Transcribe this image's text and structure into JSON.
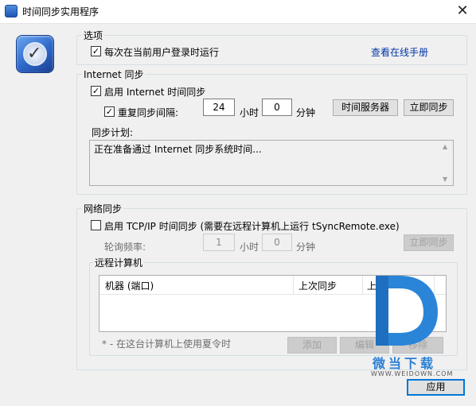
{
  "window": {
    "title": "时间同步实用程序",
    "close_glyph": "✕"
  },
  "options": {
    "legend": "选项",
    "run_at_login_label": "每次在当前用户登录时运行",
    "run_at_login_checked": true,
    "online_manual_link": "查看在线手册"
  },
  "internet_sync": {
    "legend": "Internet 同步",
    "enable_label": "启用 Internet 时间同步",
    "enable_checked": true,
    "repeat_label": "重复同步间隔:",
    "repeat_checked": true,
    "hours_value": "24",
    "hours_unit": "小时",
    "minutes_value": "0",
    "minutes_unit": "分钟",
    "time_server_button": "时间服务器",
    "sync_now_button": "立即同步",
    "schedule_label": "同步计划:",
    "schedule_text": "正在准备通过 Internet 同步系统时间..."
  },
  "network_sync": {
    "legend": "网络同步",
    "enable_label": "启用 TCP/IP 时间同步 (需要在远程计算机上运行 tSyncRemote.exe)",
    "enable_checked": false,
    "poll_label": "轮询频率:",
    "hours_value": "1",
    "hours_unit": "小时",
    "minutes_value": "0",
    "minutes_unit": "分钟",
    "sync_now_button": "立即同步",
    "remote_legend": "远程计算机",
    "columns": [
      "机器 (端口)",
      "上次同步",
      "上次尝试"
    ],
    "dst_note": "* - 在这台计算机上使用夏令时",
    "add_button": "添加",
    "edit_button": "编辑",
    "remove_button": "移除"
  },
  "apply_button": "应用",
  "watermark": {
    "text": "微当下载",
    "url": "WWW.WEIDOWN.COM"
  }
}
